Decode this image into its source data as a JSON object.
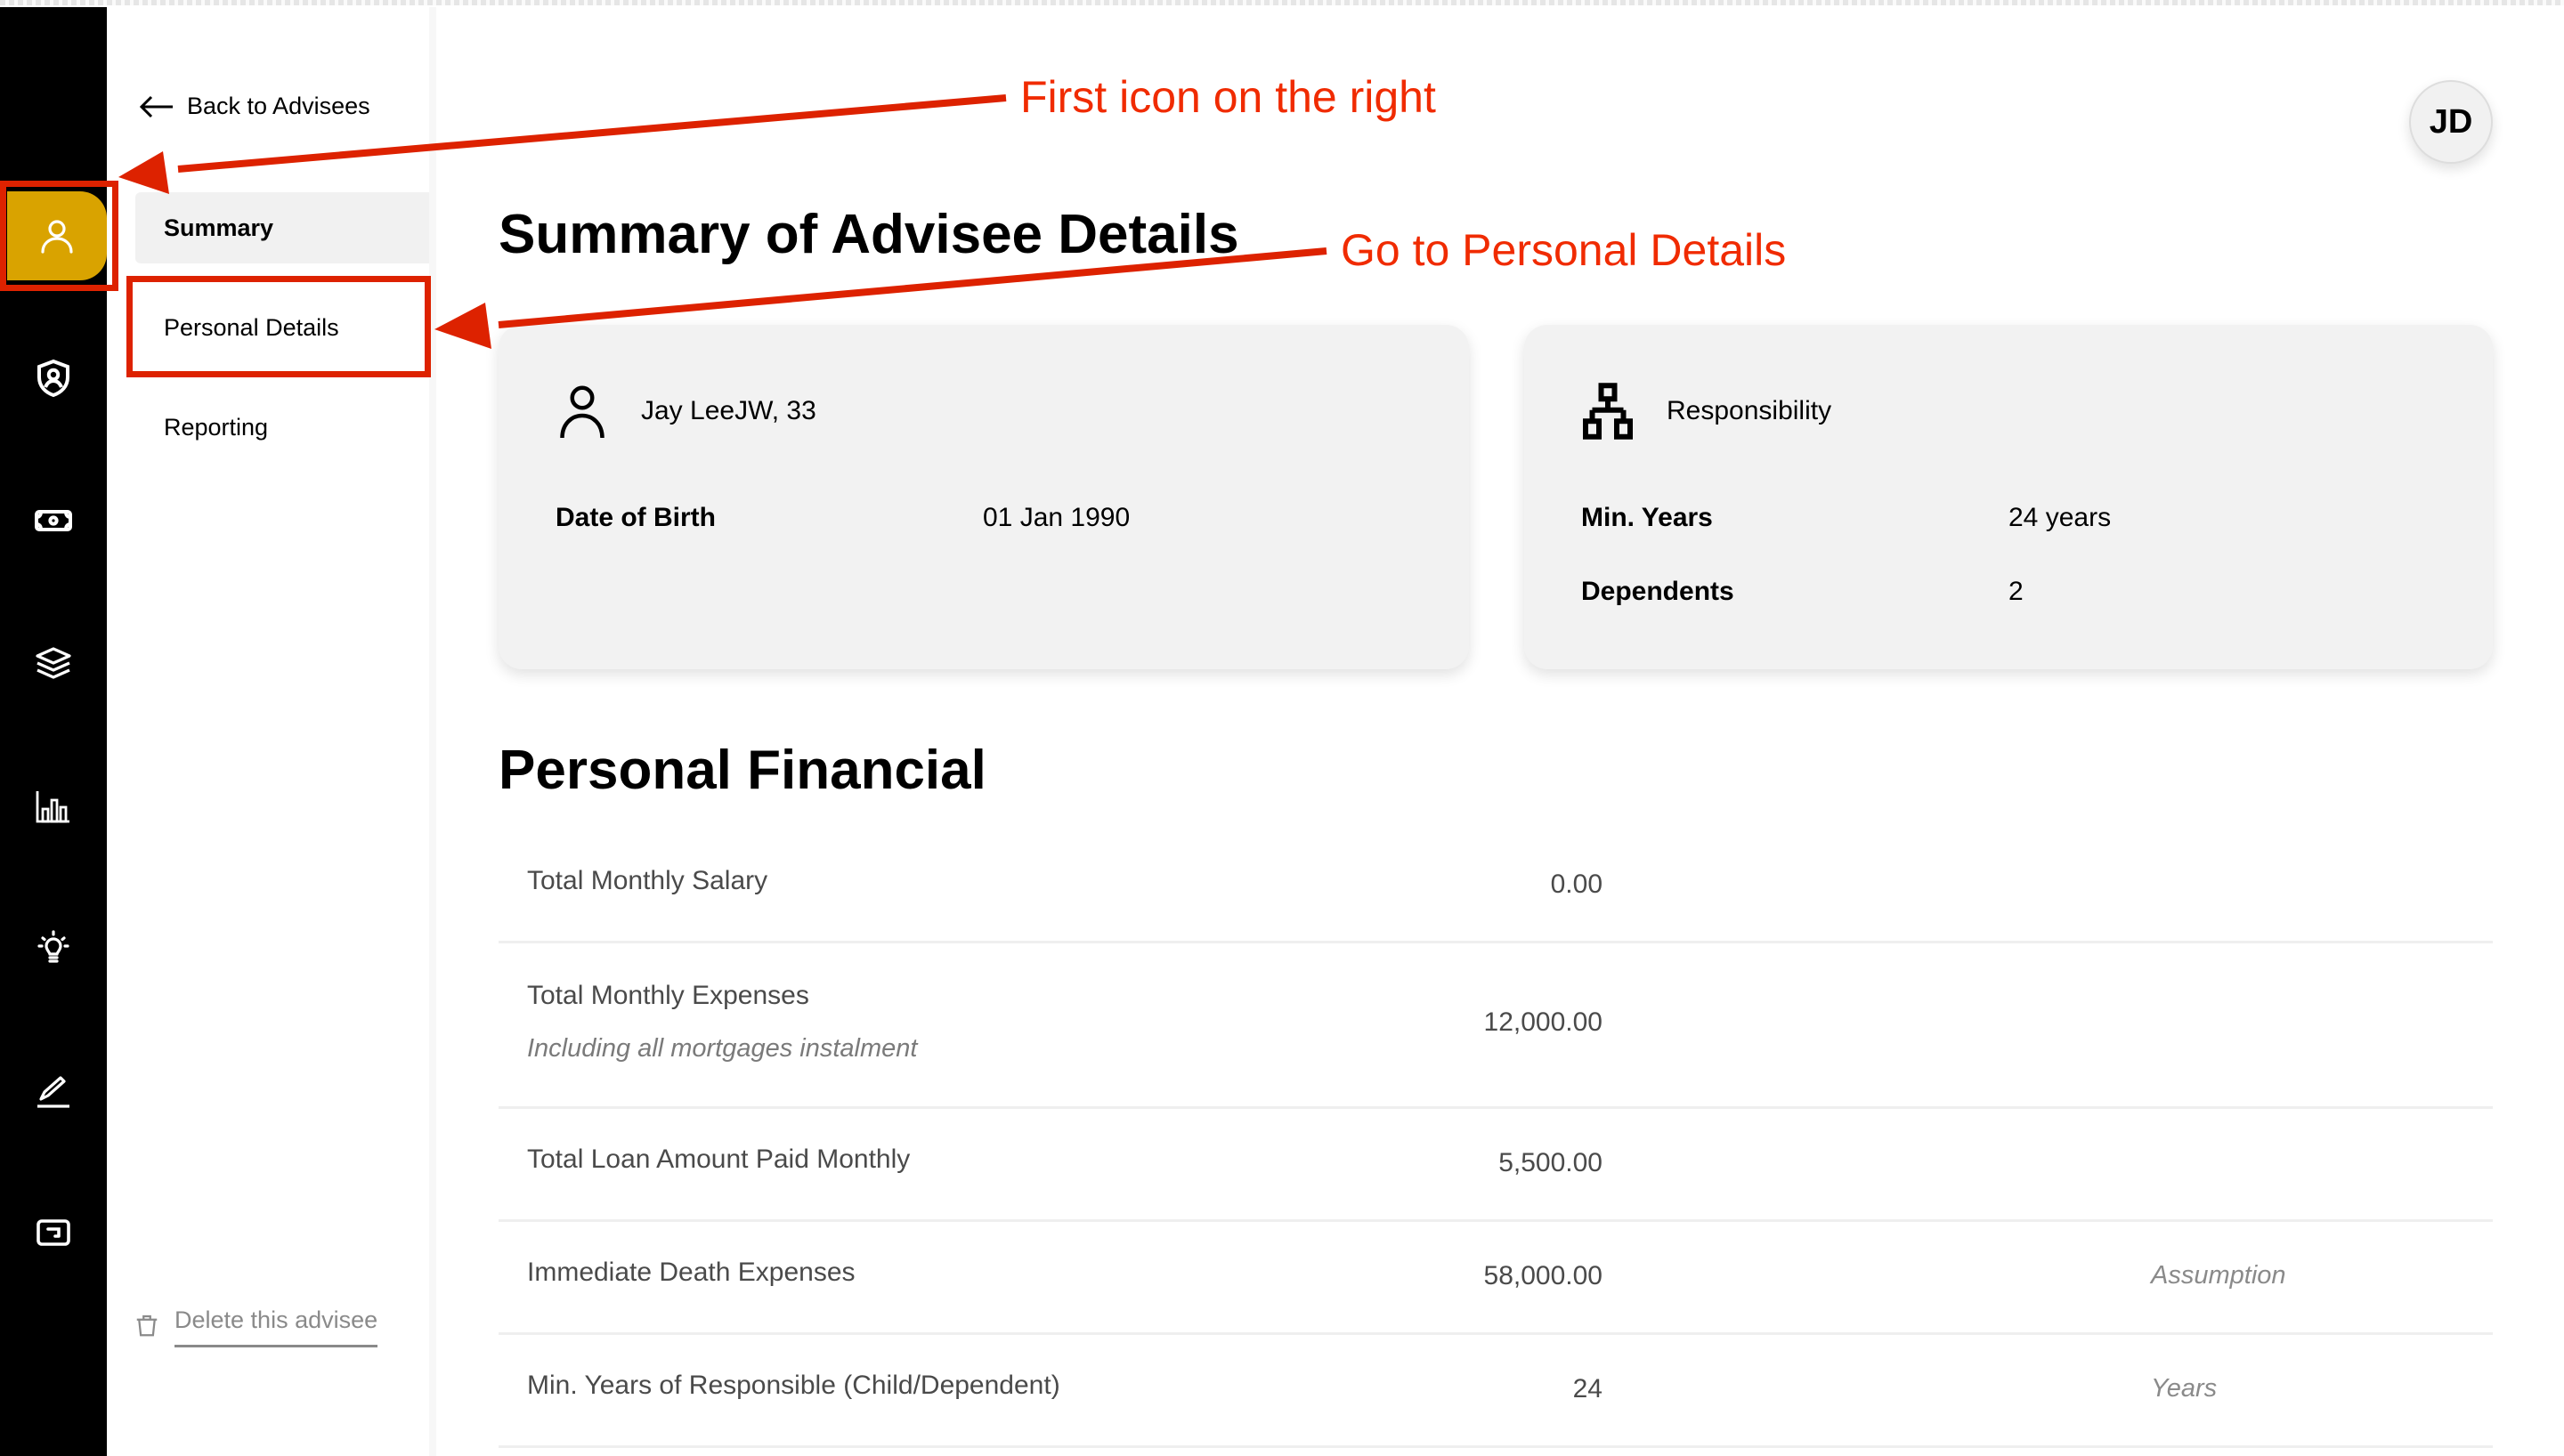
{
  "rail": {
    "items": [
      {
        "icon": "user-icon",
        "active": true
      },
      {
        "icon": "shield-user-icon",
        "active": false
      },
      {
        "icon": "money-icon",
        "active": false
      },
      {
        "icon": "layers-icon",
        "active": false
      },
      {
        "icon": "bar-chart-icon",
        "active": false
      },
      {
        "icon": "lightbulb-icon",
        "active": false
      },
      {
        "icon": "pen-icon",
        "active": false
      },
      {
        "icon": "exit-box-icon",
        "active": false
      }
    ],
    "accent_color": "#d9a300"
  },
  "subnav": {
    "back_label": "Back to Advisees",
    "items": [
      {
        "label": "Summary",
        "active": true
      },
      {
        "label": "Personal Details",
        "active": false
      },
      {
        "label": "Reporting",
        "active": false
      }
    ],
    "delete_label": "Delete this advisee"
  },
  "header": {
    "avatar_initials": "JD"
  },
  "main": {
    "title": "Summary of Advisee Details",
    "cards": {
      "person": {
        "heading": "Jay LeeJW, 33",
        "fields": [
          {
            "label": "Date of Birth",
            "value": "01 Jan 1990"
          }
        ]
      },
      "responsibility": {
        "heading": "Responsibility",
        "fields": [
          {
            "label": "Min. Years",
            "value": "24 years"
          },
          {
            "label": "Dependents",
            "value": "2"
          }
        ]
      }
    },
    "financial_title": "Personal Financial",
    "financial_rows": [
      {
        "label": "Total Monthly Salary",
        "sublabel": "",
        "value": "0.00",
        "note": ""
      },
      {
        "label": "Total Monthly Expenses",
        "sublabel": "Including all mortgages instalment",
        "value": "12,000.00",
        "note": ""
      },
      {
        "label": "Total Loan Amount Paid Monthly",
        "sublabel": "",
        "value": "5,500.00",
        "note": ""
      },
      {
        "label": "Immediate Death Expenses",
        "sublabel": "",
        "value": "58,000.00",
        "note": "Assumption"
      },
      {
        "label": "Min. Years of Responsible (Child/Dependent)",
        "sublabel": "",
        "value": "24",
        "note": "Years"
      }
    ]
  },
  "annotations": {
    "first": "First icon on the right",
    "second": "Go to Personal Details",
    "color": "#dd2200"
  }
}
